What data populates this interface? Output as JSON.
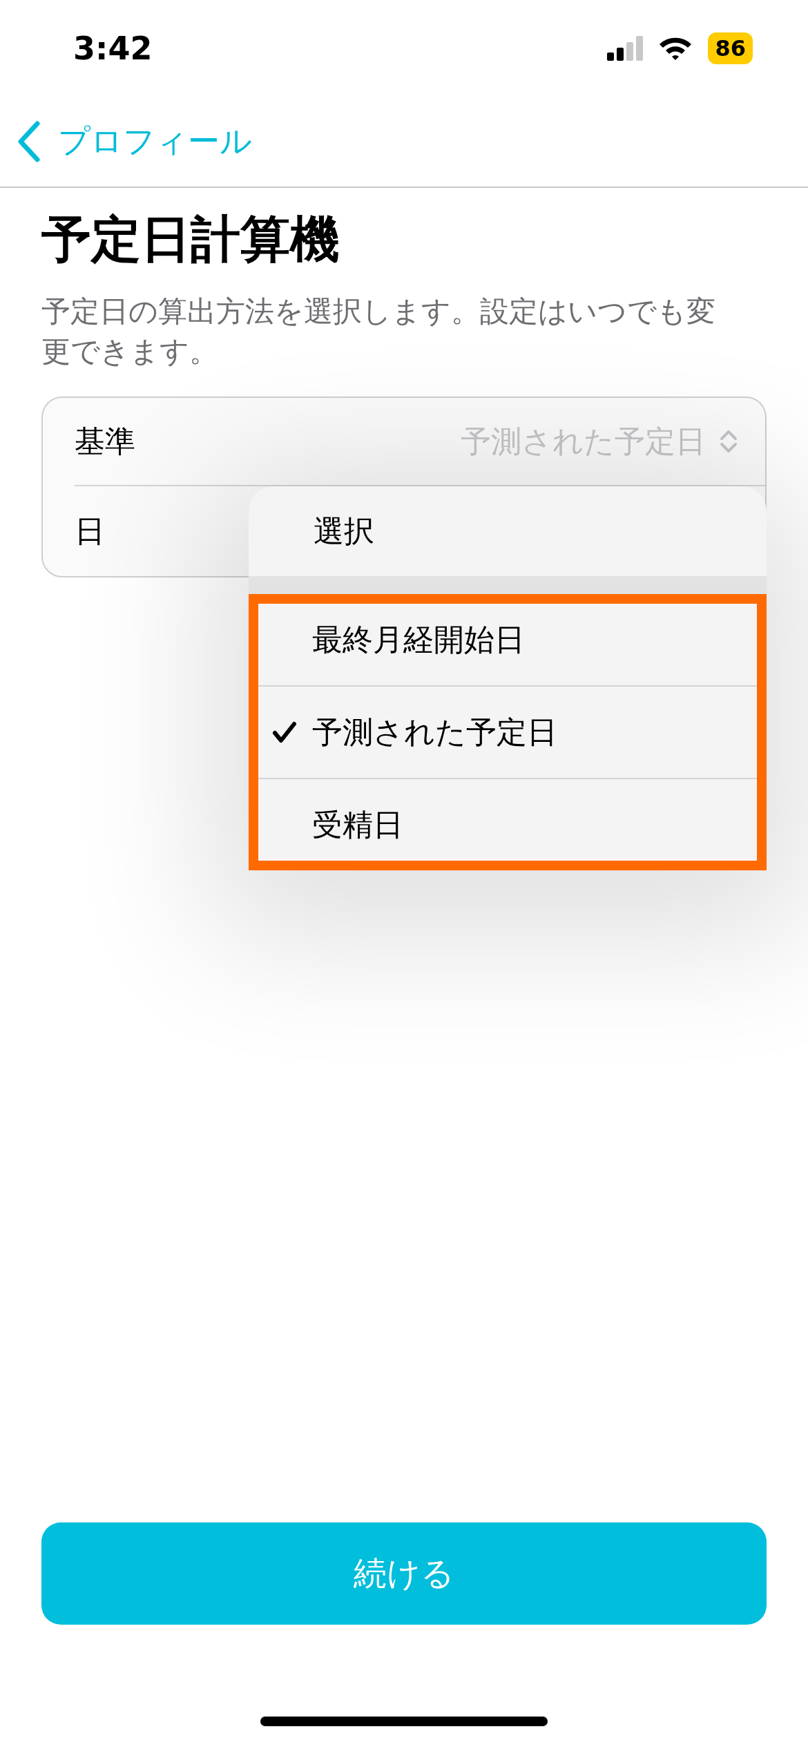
{
  "status_bar": {
    "time": "3:42",
    "battery": "86"
  },
  "nav": {
    "back_label": "プロフィール"
  },
  "title": "予定日計算機",
  "description": "予定日の算出方法を選択します。設定はいつでも変更できます。",
  "form_rows": [
    {
      "kind": "picker",
      "label": "基準",
      "value": "予測された予定日"
    },
    {
      "kind": "plain",
      "label": "日"
    }
  ],
  "menu": {
    "title": "選択",
    "highlighted": true,
    "items": [
      {
        "label": "最終月経開始日",
        "selected": false
      },
      {
        "label": "予測された予定日",
        "selected": true
      },
      {
        "label": "受精日",
        "selected": false
      }
    ]
  },
  "continue_button": "続ける"
}
